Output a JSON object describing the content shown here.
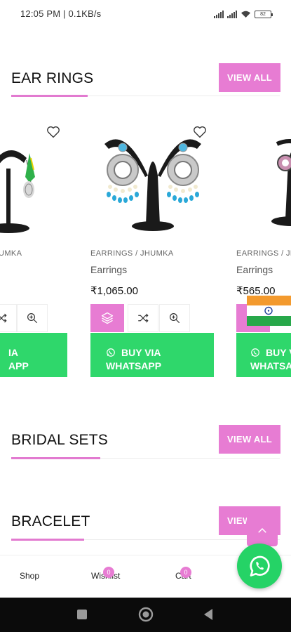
{
  "status_bar": {
    "time": "12:05 PM | 0.1KB/s",
    "battery": "82"
  },
  "sections": {
    "ear_rings": {
      "title": "EAR RINGS",
      "view_all": "VIEW ALL"
    },
    "bridal_sets": {
      "title": "BRIDAL SETS",
      "view_all": "VIEW ALL"
    },
    "bracelet": {
      "title": "BRACELET",
      "view_all": "VIEW ALL"
    }
  },
  "products": [
    {
      "category": "UMKA",
      "name": "",
      "price": "",
      "whatsapp_line1": "IA",
      "whatsapp_line2": "APP"
    },
    {
      "category": "EARRINGS / JHUMKA",
      "name": "Earrings",
      "price": "₹1,065.00",
      "whatsapp_line1": "BUY VIA",
      "whatsapp_line2": "WHATSAPP"
    },
    {
      "category": "EARRINGS / JH",
      "name": "Earrings",
      "price": "₹565.00",
      "whatsapp_line1": "BUY V",
      "whatsapp_line2": "WHATSA"
    }
  ],
  "bottom_nav": [
    {
      "label": "Shop",
      "badge": ""
    },
    {
      "label": "Wishlist",
      "badge": "0"
    },
    {
      "label": "Cart",
      "badge": "0"
    }
  ],
  "colors": {
    "accent_pink": "#e77cd3",
    "whatsapp_green": "#2fd76b"
  },
  "icons": [
    "heart-icon",
    "layers-icon",
    "shuffle-icon",
    "zoom-icon",
    "whatsapp-icon",
    "chevron-up-icon",
    "india-flag-icon"
  ]
}
